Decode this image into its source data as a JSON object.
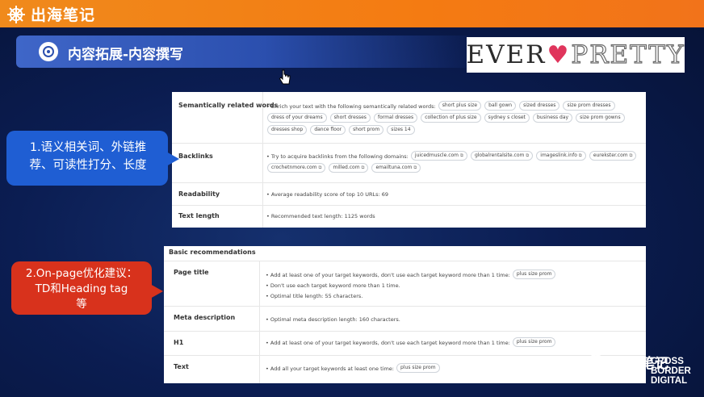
{
  "brand": {
    "name": "出海笔记",
    "icon": "ship-wheel-icon"
  },
  "title": {
    "text": "内容拓展-内容撰写",
    "icon": "target-icon"
  },
  "logo": {
    "part1": "EVER",
    "heart": "♥",
    "part2": "PRETTY"
  },
  "panel1": {
    "rows": [
      {
        "label": "Semantically related words",
        "intro": "Enrich your text with the following semantically related words:",
        "chips": [
          "short plus size",
          "ball gown",
          "sized dresses",
          "size prom dresses",
          "dress of your dreams",
          "short dresses",
          "formal dresses",
          "collection of plus size",
          "sydney s closet",
          "business day",
          "size prom gowns",
          "dresses shop",
          "dance floor",
          "short prom",
          "sizes 14"
        ]
      },
      {
        "label": "Backlinks",
        "intro": "Try to acquire backlinks from the following domains:",
        "chips": [
          "juicedmuscle.com",
          "globalrentalsite.com",
          "imageslink.info",
          "eurekster.com",
          "crochetnmore.com",
          "milled.com",
          "emailtuna.com"
        ]
      },
      {
        "label": "Readability",
        "intro": "Average readability score of top 10 URLs: 69"
      },
      {
        "label": "Text length",
        "intro": "Recommended text length: 1125 words"
      }
    ]
  },
  "panel2": {
    "header": "Basic recommendations",
    "rows": [
      {
        "label": "Page title",
        "lines": [
          "Add at least one of your target keywords, don't use each target keyword more than 1 time:",
          "Don't use each target keyword more than 1 time.",
          "Optimal title length: 55 characters."
        ],
        "chip": "plus size prom"
      },
      {
        "label": "Meta description",
        "lines": [
          "Optimal meta description length: 160 characters."
        ]
      },
      {
        "label": "H1",
        "lines": [
          "Add at least one of your target keywords, don't use each target keyword more than 1 time:"
        ],
        "chip": "plus size prom"
      },
      {
        "label": "Text",
        "lines": [
          "Add all your target keywords at least one time:"
        ],
        "chip": "plus size prom"
      }
    ]
  },
  "callout1": {
    "line1": "1.语义相关词、外链推",
    "line2": "荐、可读性打分、长度"
  },
  "callout2": {
    "line1": "2.On-page优化建议：",
    "line2": "TD和Heading tag",
    "line3": "等"
  },
  "watermark": {
    "text": "出海笔记",
    "icon": "wechat-icon"
  },
  "corner_logo": {
    "line1": "CROSS",
    "line2": "BORDER",
    "line3": "DIGITAL"
  },
  "colors": {
    "topbar": "#f47b12",
    "callout_blue": "#1f5ed3",
    "callout_red": "#d8321c",
    "heart": "#e0355c"
  }
}
